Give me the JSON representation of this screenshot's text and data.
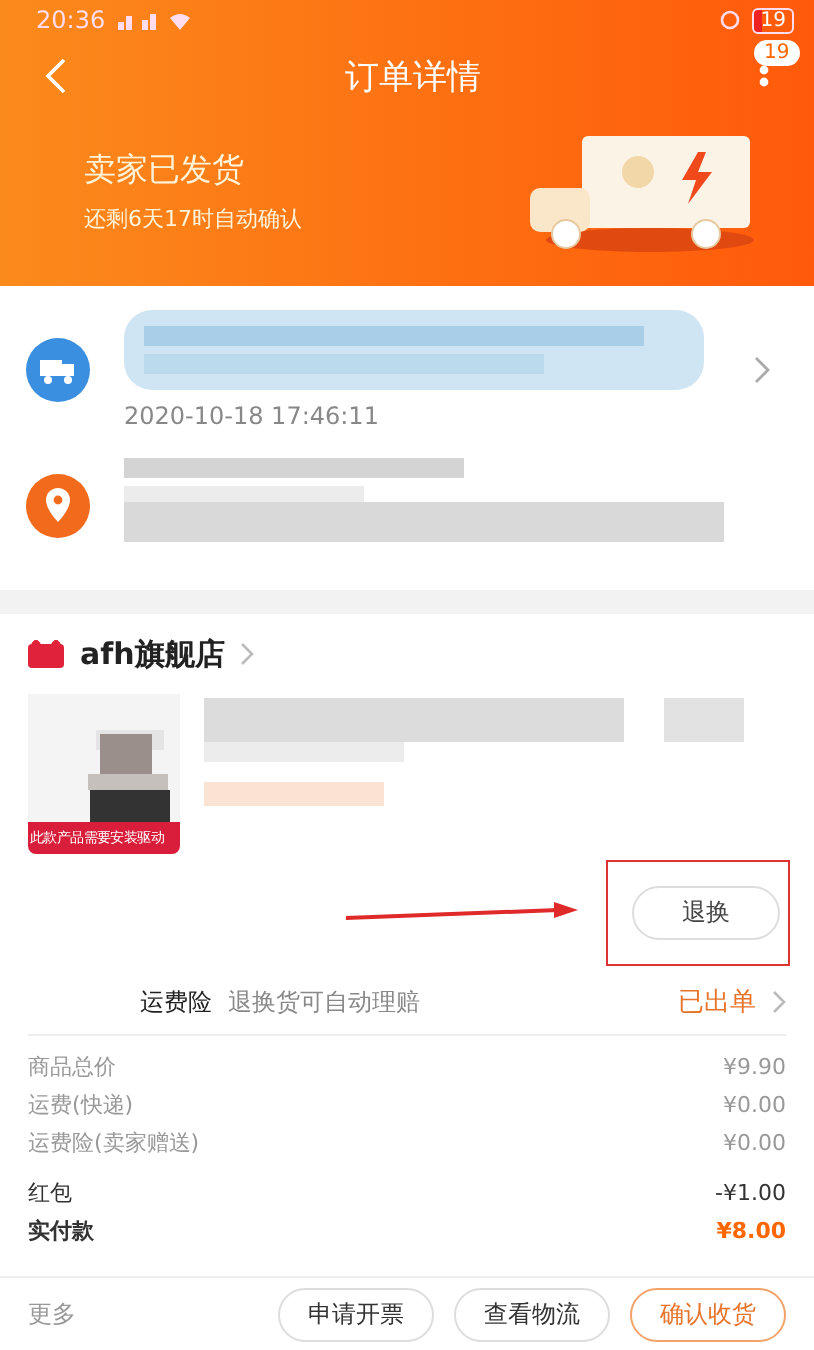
{
  "status_bar": {
    "time": "20:36",
    "battery": "19"
  },
  "header": {
    "title": "订单详情",
    "badge": "19"
  },
  "banner": {
    "status": "卖家已发货",
    "countdown": "还剩6天17时自动确认"
  },
  "logistics": {
    "time": "2020-10-18 17:46:11"
  },
  "store": {
    "name": "afh旗舰店"
  },
  "product": {
    "image_label": "此款产品需要安装驱动",
    "action": "退换"
  },
  "insurance": {
    "label": "运费险",
    "description": "退换货可自动理赔",
    "status": "已出单"
  },
  "costs": [
    {
      "label": "商品总价",
      "value": "¥9.90",
      "kind": "item"
    },
    {
      "label": "运费(快递)",
      "value": "¥0.00",
      "kind": "item"
    },
    {
      "label": "运费险(卖家赠送)",
      "value": "¥0.00",
      "kind": "item"
    },
    {
      "label": "红包",
      "value": "-¥1.00",
      "kind": "discount"
    },
    {
      "label": "实付款",
      "value": "¥8.00",
      "kind": "total"
    }
  ],
  "actions": {
    "more": "更多",
    "buttons": [
      {
        "label": "申请开票",
        "primary": false
      },
      {
        "label": "查看物流",
        "primary": false
      },
      {
        "label": "确认收货",
        "primary": true
      }
    ]
  }
}
